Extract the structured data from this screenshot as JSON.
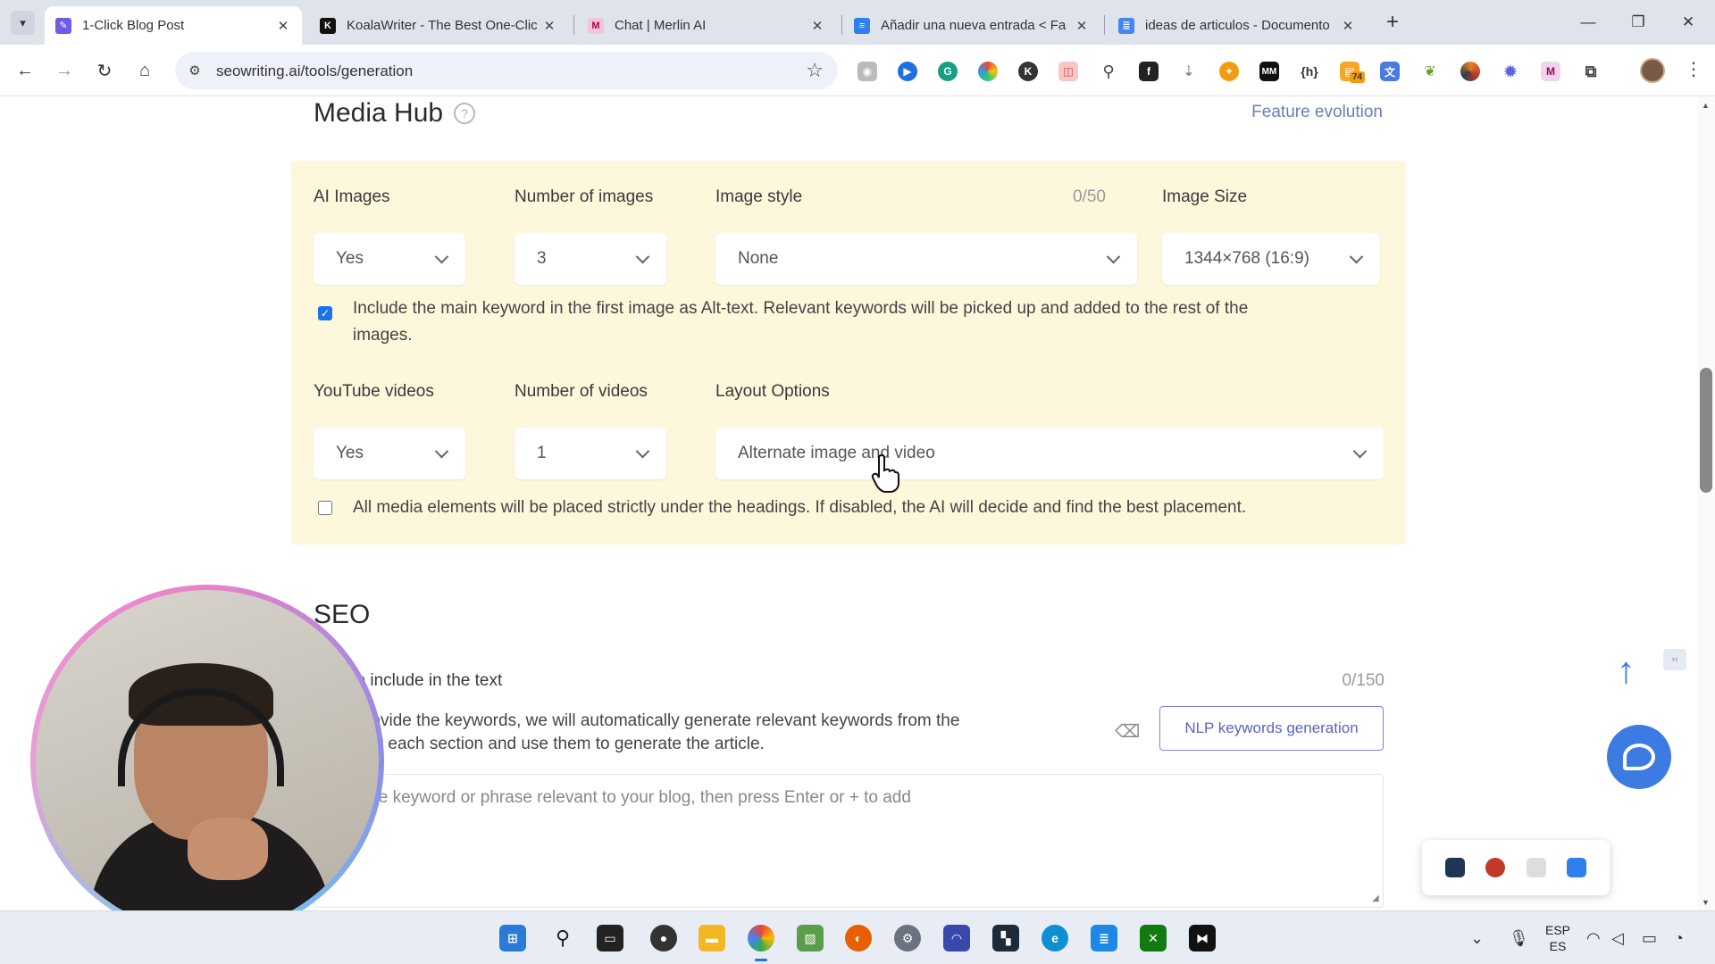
{
  "browser": {
    "tabs": [
      {
        "title": "1-Click Blog Post",
        "active": true,
        "favicon": "pen-icon"
      },
      {
        "title": "KoalaWriter - The Best One-Clic",
        "active": false,
        "favicon": "koala-k-icon"
      },
      {
        "title": "Chat | Merlin AI",
        "active": false,
        "favicon": "merlin-icon"
      },
      {
        "title": "Añadir una nueva entrada < Fa",
        "active": false,
        "favicon": "wordpress-icon"
      },
      {
        "title": "ideas de articulos - Documento",
        "active": false,
        "favicon": "google-docs-icon"
      }
    ],
    "url": "seowriting.ai/tools/generation",
    "extension_badge": "74"
  },
  "media_hub": {
    "title": "Media Hub",
    "feature_link": "Feature evolution",
    "ai_images": {
      "label": "AI Images",
      "value": "Yes"
    },
    "number_of_images": {
      "label": "Number of images",
      "value": "3"
    },
    "image_style": {
      "label": "Image style",
      "value": "None",
      "counter": "0/50"
    },
    "image_size": {
      "label": "Image Size",
      "value": "1344×768 (16:9)"
    },
    "alt_text_checkbox": {
      "checked": true,
      "text_line1": "Include the main keyword in the first image as Alt-text. Relevant keywords will be picked up and added to the rest of the",
      "text_line2": "images."
    },
    "youtube_videos": {
      "label": "YouTube videos",
      "value": "Yes"
    },
    "number_of_videos": {
      "label": "Number of videos",
      "value": "1"
    },
    "layout_options": {
      "label": "Layout Options",
      "value": "Alternate image and video"
    },
    "placement_checkbox": {
      "checked": false,
      "text": "All media elements will be placed strictly under the headings. If disabled, the AI will decide and find the best placement."
    }
  },
  "seo": {
    "title": "SEO",
    "keywords_label": "ords to include in the text",
    "keywords_counter": "0/150",
    "desc_line1": "o not provide the keywords, we will automatically generate relevant keywords from the",
    "desc_line2": "yword for each section and use them to generate the article.",
    "nlp_button": "NLP keywords generation",
    "textarea_placeholder": "e some keyword or phrase relevant to your blog, then press Enter or + to add"
  },
  "taskbar": {
    "lang_top": "ESP",
    "lang_bottom": "ES"
  },
  "colors": {
    "panel_bg": "#fdf7dc",
    "accent_link": "#6b7fb6",
    "nlp_border": "#8a7be0",
    "chat_blue": "#3d7be3"
  }
}
